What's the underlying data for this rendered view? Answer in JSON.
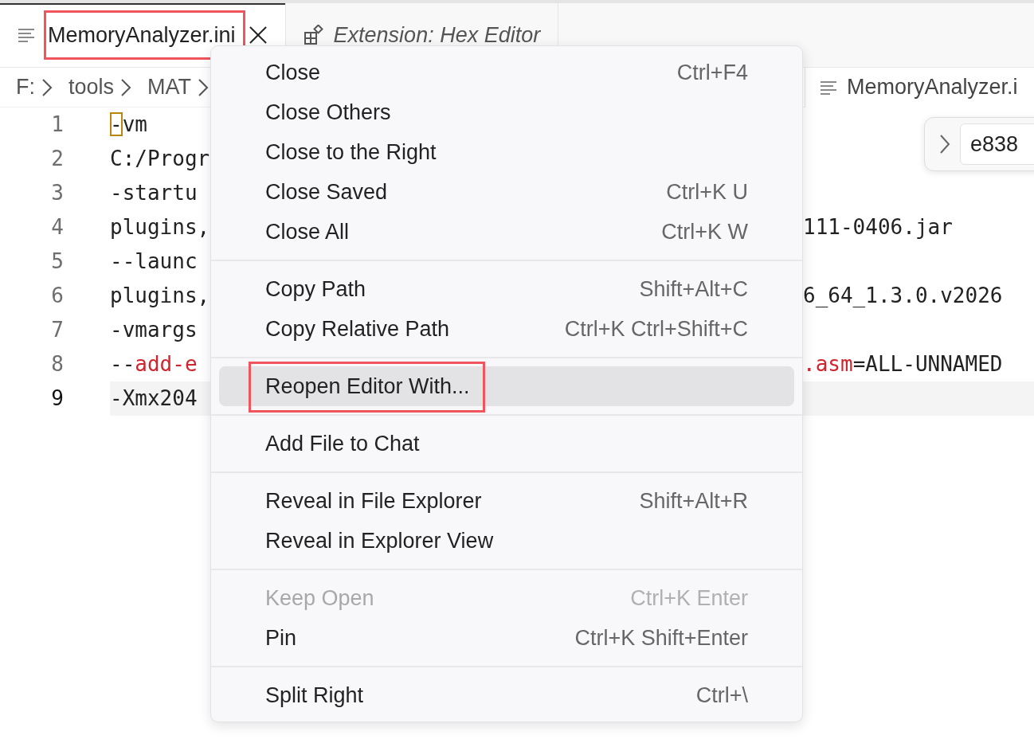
{
  "tabs": [
    {
      "label": "MemoryAnalyzer.ini",
      "selected": true,
      "kind": "file",
      "annotated": true
    },
    {
      "label": "Extension: Hex Editor",
      "selected": false,
      "kind": "extension",
      "annotated": false
    }
  ],
  "breadcrumb": [
    "F:",
    "tools",
    "MAT"
  ],
  "side_tab": {
    "label": "MemoryAnalyzer.i"
  },
  "find_widget": {
    "value": "e838"
  },
  "editor": {
    "lines": [
      {
        "number": "1",
        "current": false,
        "left": [
          {
            "text": "-",
            "kind": "bracket"
          },
          {
            "text": "vm",
            "kind": "plain"
          }
        ]
      },
      {
        "number": "2",
        "current": false,
        "left": [
          {
            "text": "C:/Progr",
            "kind": "plain"
          }
        ]
      },
      {
        "number": "3",
        "current": false,
        "left": [
          {
            "text": "-startu",
            "kind": "plain"
          }
        ]
      },
      {
        "number": "4",
        "current": false,
        "left": [
          {
            "text": "plugins,",
            "kind": "plain"
          }
        ],
        "right": [
          {
            "text": "111-0406.jar",
            "kind": "plain"
          }
        ]
      },
      {
        "number": "5",
        "current": false,
        "left": [
          {
            "text": "--launc",
            "kind": "plain"
          }
        ]
      },
      {
        "number": "6",
        "current": false,
        "left": [
          {
            "text": "plugins,",
            "kind": "plain"
          }
        ],
        "right": [
          {
            "text": "6_64_1.3.0.v2026",
            "kind": "plain"
          }
        ]
      },
      {
        "number": "7",
        "current": false,
        "left": [
          {
            "text": "-vmargs",
            "kind": "plain"
          }
        ]
      },
      {
        "number": "8",
        "current": false,
        "left": [
          {
            "text": "--",
            "kind": "plain"
          },
          {
            "text": "add-e",
            "kind": "red"
          }
        ],
        "right": [
          {
            "text": ".asm",
            "kind": "red"
          },
          {
            "text": "=ALL-UNNAMED",
            "kind": "plain"
          }
        ]
      },
      {
        "number": "9",
        "current": true,
        "left": [
          {
            "text": "-Xmx204",
            "kind": "plain"
          }
        ]
      }
    ]
  },
  "context_menu": {
    "sections": [
      {
        "items": [
          {
            "label": "Close",
            "shortcut": "Ctrl+F4",
            "selected": false,
            "disabled": false,
            "annotated": false
          },
          {
            "label": "Close Others",
            "selected": false,
            "disabled": false,
            "annotated": false
          },
          {
            "label": "Close to the Right",
            "selected": false,
            "disabled": false,
            "annotated": false
          },
          {
            "label": "Close Saved",
            "shortcut": "Ctrl+K U",
            "selected": false,
            "disabled": false,
            "annotated": false
          },
          {
            "label": "Close All",
            "shortcut": "Ctrl+K W",
            "selected": false,
            "disabled": false,
            "annotated": false
          }
        ]
      },
      {
        "items": [
          {
            "label": "Copy Path",
            "shortcut": "Shift+Alt+C",
            "selected": false,
            "disabled": false,
            "annotated": false
          },
          {
            "label": "Copy Relative Path",
            "shortcut": "Ctrl+K Ctrl+Shift+C",
            "selected": false,
            "disabled": false,
            "annotated": false
          }
        ]
      },
      {
        "items": [
          {
            "label": "Reopen Editor With...",
            "selected": true,
            "disabled": false,
            "annotated": true
          }
        ]
      },
      {
        "items": [
          {
            "label": "Add File to Chat",
            "selected": false,
            "disabled": false,
            "annotated": false
          }
        ]
      },
      {
        "items": [
          {
            "label": "Reveal in File Explorer",
            "shortcut": "Shift+Alt+R",
            "selected": false,
            "disabled": false,
            "annotated": false
          },
          {
            "label": "Reveal in Explorer View",
            "selected": false,
            "disabled": false,
            "annotated": false
          }
        ]
      },
      {
        "items": [
          {
            "label": "Keep Open",
            "shortcut": "Ctrl+K Enter",
            "selected": false,
            "disabled": true,
            "annotated": false
          },
          {
            "label": "Pin",
            "shortcut": "Ctrl+K Shift+Enter",
            "selected": false,
            "disabled": false,
            "annotated": false
          }
        ]
      },
      {
        "items": [
          {
            "label": "Split Right",
            "shortcut": "Ctrl+\\",
            "selected": false,
            "disabled": false,
            "annotated": false
          }
        ]
      }
    ]
  }
}
